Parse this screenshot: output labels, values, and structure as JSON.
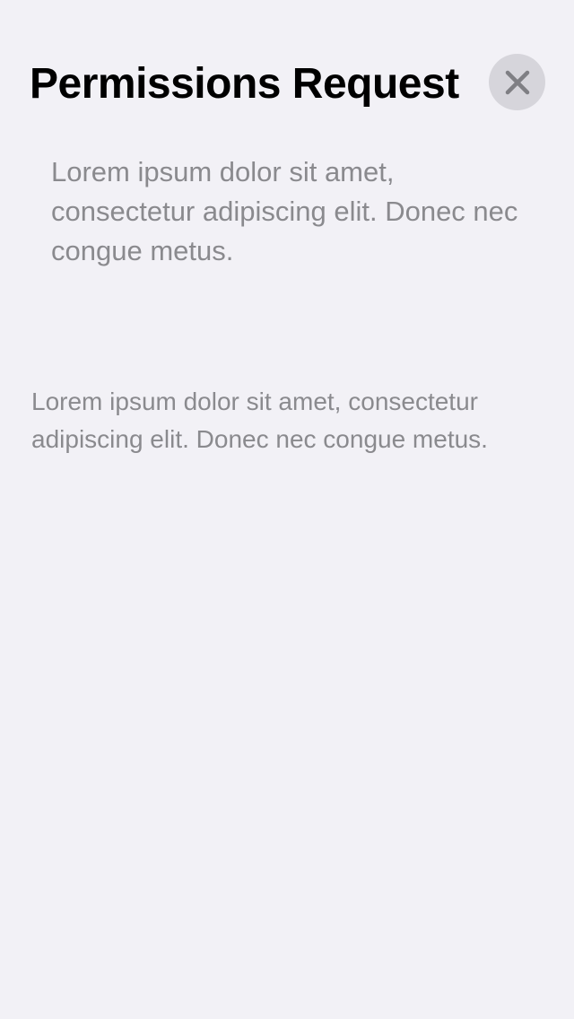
{
  "header": {
    "title": "Permissions Request",
    "close_icon": "close-icon"
  },
  "content": {
    "primary_text": "Lorem ipsum dolor sit amet, consectetur adipiscing elit. Donec nec congue metus.",
    "secondary_text": "Lorem ipsum dolor sit amet, consectetur adipiscing elit. Donec nec congue metus."
  },
  "colors": {
    "background": "#f2f1f6",
    "title": "#000000",
    "body_text": "#8a8a8e",
    "close_button_bg": "#d6d5db",
    "close_icon": "#7f7f84"
  }
}
